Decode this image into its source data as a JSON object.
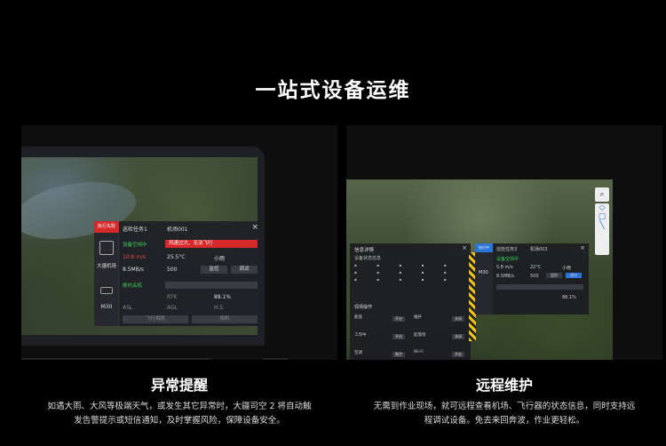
{
  "hero": {
    "title": "一站式设备运维"
  },
  "left": {
    "caption_title": "异常提醒",
    "caption_desc_line1": "如遇大雨、大风等极端天气，或发生其它异常时，大疆司空 2 将自动触",
    "caption_desc_line2": "发告警提示或短信通知，及时掌握风险，保障设备安全。",
    "card": {
      "alert_tag": "执行失败",
      "task_name": "巡检任务1",
      "dock_id": "机场001",
      "dock_name": "大疆机场",
      "drone_name": "M30",
      "dock_status": "设备空闲中",
      "warning": "风速过大、无法飞行",
      "wind": "10.8 m/s",
      "temp": "25.5°C",
      "weather": "小雨",
      "network": "8.5MB/s",
      "storage": "500",
      "monitor_btn": "监控",
      "debug_btn": "调试",
      "drone_status": "舱内关机",
      "rtk": "RTK",
      "battery": "88.1%",
      "asl": "ASL",
      "agl": "AGL",
      "hs": "H.S",
      "fly_to_btn": "飞行相机",
      "camera_btn": "相机"
    }
  },
  "right": {
    "caption_title": "远程维护",
    "caption_desc_line1": "无需到作业现场，就可远程查看机场、飞行器的状态信息，同时支持远",
    "caption_desc_line2": "程调试设备。免去来回奔波，作业更轻松。",
    "info_panel": {
      "title": "信息详情",
      "subtitle": "设备状态信息",
      "section": "现场操作",
      "items": [
        "舱盖",
        "推杆",
        "工作中",
        "起落架",
        "空调",
        "Wi-Fi"
      ],
      "buttons": [
        "开启",
        "关闭",
        "开启",
        "关闭",
        "制冷",
        "开启"
      ]
    },
    "dock2": {
      "task": "巡检任务3",
      "dock_id": "机场003",
      "tag": "执行中",
      "status": "设备空闲中",
      "wind": "5.8 m/s",
      "temp": "22°C",
      "weather": "小雨",
      "network": "8.5MB/s",
      "storage": "500",
      "monitor": "监控",
      "debug": "调试",
      "drone": "M30",
      "battery": "88.1%"
    }
  },
  "colors": {
    "alert_red": "#d62a2a",
    "status_green": "#3ccf5c",
    "accent_blue": "#2a73d9"
  }
}
